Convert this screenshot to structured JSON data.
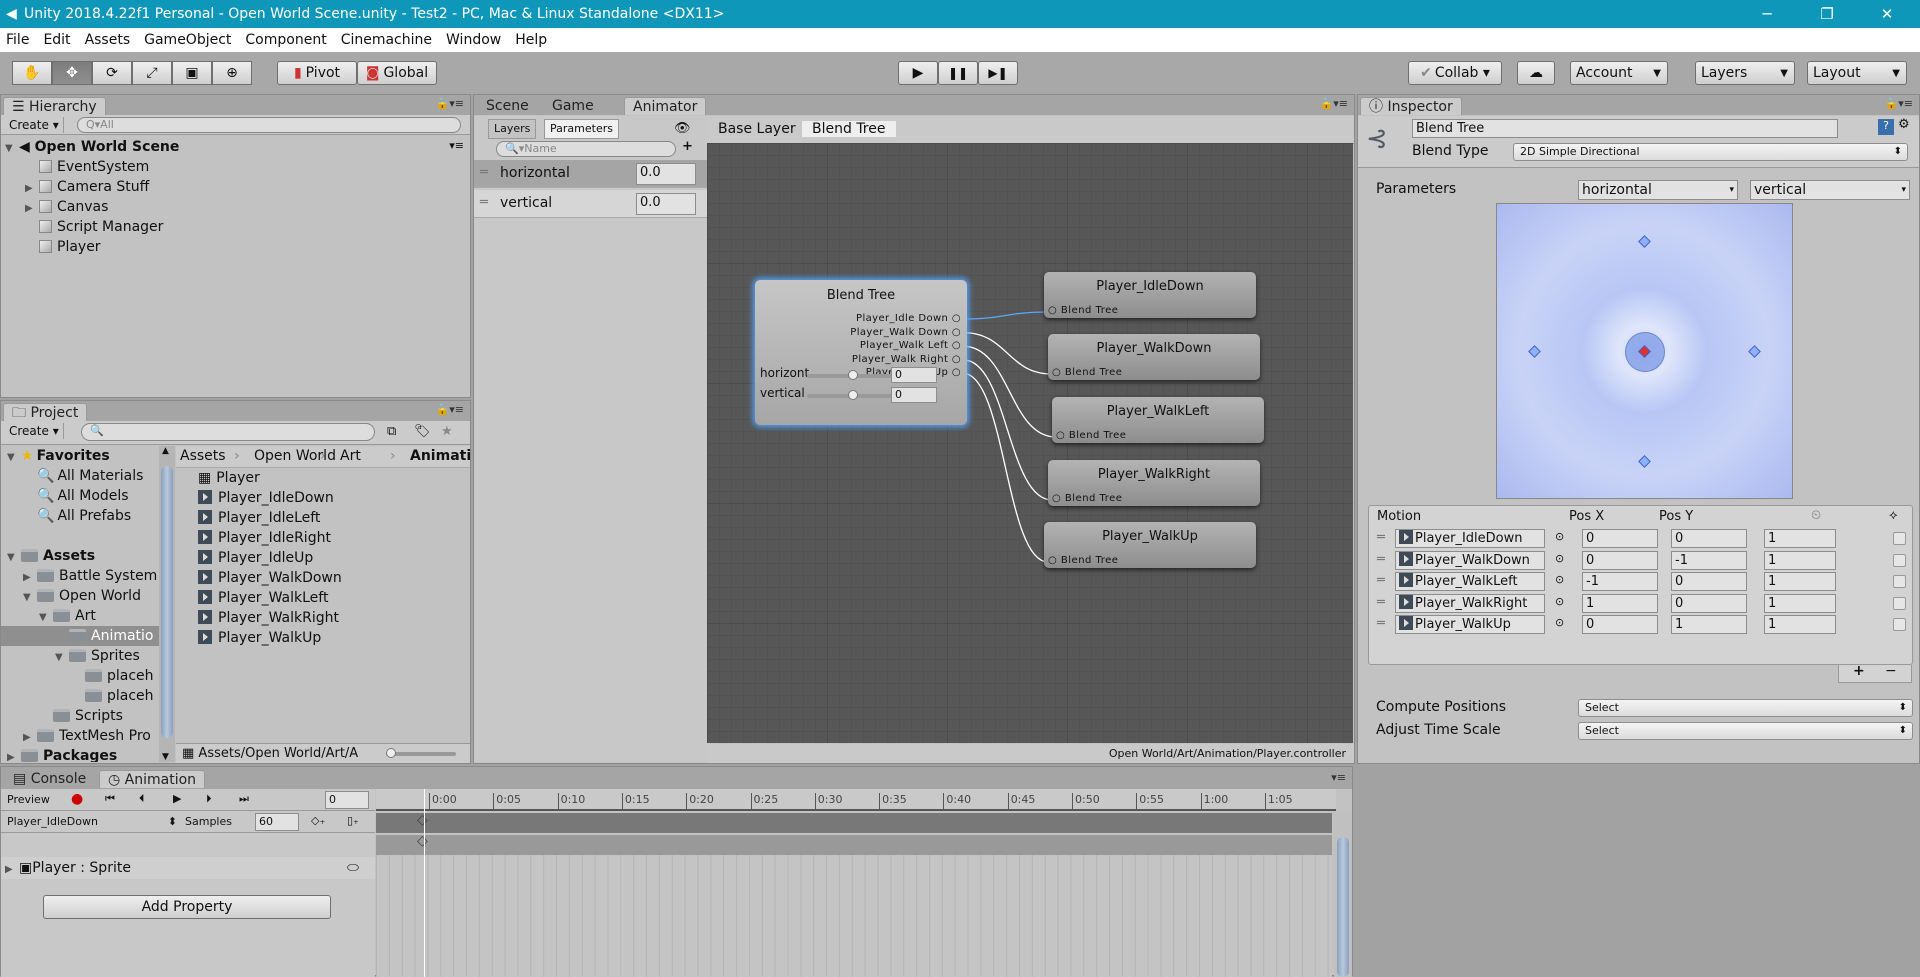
{
  "window": {
    "title": "Unity 2018.4.22f1 Personal - Open World Scene.unity - Test2 - PC, Mac & Linux Standalone <DX11>",
    "minimize": "─",
    "restore": "❐",
    "close": "✕"
  },
  "menu": [
    "File",
    "Edit",
    "Assets",
    "GameObject",
    "Component",
    "Cinemachine",
    "Window",
    "Help"
  ],
  "toolbar": {
    "tools": [
      "hand-tool",
      "move-tool",
      "rotate-tool",
      "scale-tool",
      "rect-tool",
      "transform-tool"
    ],
    "tool_glyphs": [
      "✋",
      "✥",
      "⟳",
      "⤢",
      "▣",
      "⊕"
    ],
    "active_tool": "move-tool",
    "pivot": "Pivot",
    "global": "Global",
    "play": "▶",
    "pause": "❚❚",
    "step": "▶❚",
    "collab": "Collab",
    "cloud": "☁",
    "account": "Account",
    "layers": "Layers",
    "layout": "Layout"
  },
  "hierarchy": {
    "tab": "Hierarchy",
    "create": "Create",
    "search_placeholder": "Q▾All",
    "scene": "Open World Scene",
    "items": [
      {
        "label": "EventSystem",
        "expandable": false
      },
      {
        "label": "Camera Stuff",
        "expandable": true
      },
      {
        "label": "Canvas",
        "expandable": true
      },
      {
        "label": "Script Manager",
        "expandable": false
      },
      {
        "label": "Player",
        "expandable": false
      }
    ]
  },
  "project": {
    "tab": "Project",
    "create": "Create",
    "tree": [
      {
        "label": "Favorites",
        "level": 0,
        "bold": true,
        "icon": "star",
        "arrow": "down"
      },
      {
        "label": "All Materials",
        "level": 1,
        "icon": "search"
      },
      {
        "label": "All Models",
        "level": 1,
        "icon": "search"
      },
      {
        "label": "All Prefabs",
        "level": 1,
        "icon": "search"
      },
      {
        "label": "",
        "level": 0,
        "icon": "none"
      },
      {
        "label": "Assets",
        "level": 0,
        "bold": true,
        "icon": "folder",
        "arrow": "down"
      },
      {
        "label": "Battle System",
        "level": 1,
        "icon": "folder",
        "arrow": "right"
      },
      {
        "label": "Open World",
        "level": 1,
        "icon": "folder",
        "arrow": "down"
      },
      {
        "label": "Art",
        "level": 2,
        "icon": "folder",
        "arrow": "down"
      },
      {
        "label": "Animatio",
        "level": 3,
        "icon": "folder",
        "selected": true
      },
      {
        "label": "Sprites",
        "level": 3,
        "icon": "folder",
        "arrow": "down"
      },
      {
        "label": "placeh",
        "level": 4,
        "icon": "folder"
      },
      {
        "label": "placeh",
        "level": 4,
        "icon": "folder"
      },
      {
        "label": "Scripts",
        "level": 2,
        "icon": "folder"
      },
      {
        "label": "TextMesh Pro",
        "level": 1,
        "icon": "folder",
        "arrow": "right"
      },
      {
        "label": "Packages",
        "level": 0,
        "bold": true,
        "icon": "folder",
        "arrow": "right"
      }
    ],
    "breadcrumb": [
      "Assets",
      "Open World",
      "Art",
      "Animati"
    ],
    "files": [
      "Player",
      "Player_IdleDown",
      "Player_IdleLeft",
      "Player_IdleRight",
      "Player_IdleUp",
      "Player_WalkDown",
      "Player_WalkLeft",
      "Player_WalkRight",
      "Player_WalkUp"
    ],
    "footer_path": "Assets/Open World/Art/A"
  },
  "center": {
    "tabs": [
      "Scene",
      "Game",
      "Animator"
    ],
    "active": "Animator",
    "sub_tabs": [
      "Layers",
      "Parameters"
    ],
    "param_search": "Name",
    "params": [
      {
        "name": "horizontal",
        "value": "0.0"
      },
      {
        "name": "vertical",
        "value": "0.0"
      }
    ],
    "breadcrumb": [
      "Base Layer",
      "Blend Tree"
    ],
    "status_path": "Open World/Art/Animation/Player.controller"
  },
  "graph": {
    "blend_tree": {
      "title": "Blend Tree",
      "outputs": [
        "Player_Idle Down",
        "Player_Walk Down",
        "Player_Walk Left",
        "Player_Walk Right",
        "Player_Walk Up"
      ],
      "sliders": [
        {
          "label": "horizont",
          "value": "0",
          "fraction": 0.5
        },
        {
          "label": "vertical",
          "value": "0",
          "fraction": 0.5
        }
      ]
    },
    "nodes": [
      {
        "title": "Player_IdleDown",
        "input": "Blend Tree",
        "highlighted": true
      },
      {
        "title": "Player_WalkDown",
        "input": "Blend Tree"
      },
      {
        "title": "Player_WalkLeft",
        "input": "Blend Tree"
      },
      {
        "title": "Player_WalkRight",
        "input": "Blend Tree"
      },
      {
        "title": "Player_WalkUp",
        "input": "Blend Tree"
      }
    ],
    "edge_color": "#ffffff",
    "highlight_color": "#5aa9ff"
  },
  "inspector": {
    "tab": "Inspector",
    "name": "Blend Tree",
    "blend_type_label": "Blend Type",
    "blend_type": "2D Simple Directional",
    "parameters_label": "Parameters",
    "param_x": "horizontal",
    "param_y": "vertical",
    "motion_header": [
      "Motion",
      "Pos X",
      "Pos Y"
    ],
    "motions": [
      {
        "name": "Player_IdleDown",
        "x": "0",
        "y": "0",
        "speed": "1"
      },
      {
        "name": "Player_WalkDown",
        "x": "0",
        "y": "-1",
        "speed": "1"
      },
      {
        "name": "Player_WalkLeft",
        "x": "-1",
        "y": "0",
        "speed": "1"
      },
      {
        "name": "Player_WalkRight",
        "x": "1",
        "y": "0",
        "speed": "1"
      },
      {
        "name": "Player_WalkUp",
        "x": "0",
        "y": "1",
        "speed": "1"
      }
    ],
    "add": "+",
    "remove": "−",
    "compute_label": "Compute Positions",
    "compute_value": "Select",
    "adjust_label": "Adjust Time Scale",
    "adjust_value": "Select"
  },
  "bottom": {
    "tabs": [
      "Console",
      "Animation"
    ],
    "active": "Animation",
    "preview": "Preview",
    "frame": "0",
    "clip": "Player_IdleDown",
    "samples_label": "Samples",
    "samples": "60",
    "property": "Player : Sprite",
    "add_property": "Add Property",
    "timeline_labels": [
      "0:00",
      "0:05",
      "0:10",
      "0:15",
      "0:20",
      "0:25",
      "0:30",
      "0:35",
      "0:40",
      "0:45",
      "0:50",
      "0:55",
      "1:00",
      "1:05"
    ]
  }
}
